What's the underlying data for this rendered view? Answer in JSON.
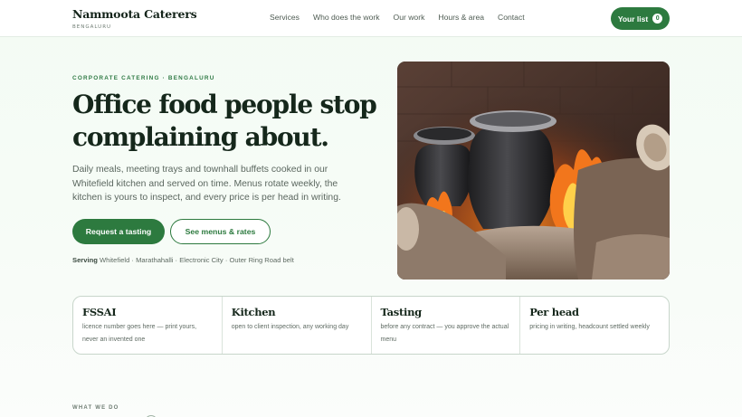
{
  "brand": {
    "name": "Nammoota Caterers",
    "subtitle": "BENGALURU"
  },
  "nav": {
    "links": [
      "Services",
      "Who does the work",
      "Our work",
      "Hours & area",
      "Contact"
    ],
    "list_label": "Your list",
    "list_count": "0"
  },
  "hero": {
    "eyebrow": "CORPORATE CATERING · BENGALURU",
    "headline": "Office food people stop complaining about.",
    "lede": "Daily meals, meeting trays and townhall buffets cooked in our Whitefield kitchen and served on time. Menus rotate weekly, the kitchen is yours to inspect, and every price is per head in writing.",
    "primary_cta": "Request a tasting",
    "secondary_cta": "See menus & rates",
    "serving_label": "Serving",
    "serving_areas": "Whitefield · Marathahalli · Electronic City · Outer Ring Road belt",
    "image": "pots-on-wood-fire"
  },
  "facts": [
    {
      "title": "FSSAI",
      "text": "licence number goes here — print yours, never an invented one"
    },
    {
      "title": "Kitchen",
      "text": "open to client inspection, any working day"
    },
    {
      "title": "Tasting",
      "text": "before any contract — you approve the actual menu"
    },
    {
      "title": "Per head",
      "text": "pricing in writing, headcount settled weekly"
    }
  ],
  "section": {
    "label": "WHAT WE DO"
  },
  "colors": {
    "accent": "#2d7a3f",
    "ink": "#15271b",
    "background": "#f3fbf4"
  }
}
